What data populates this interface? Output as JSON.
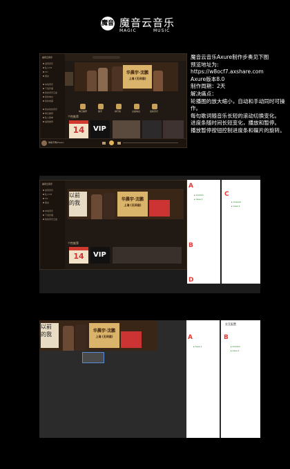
{
  "logo": {
    "cn": "魔音云音乐",
    "en_left": "MAGIC",
    "en_right": "MUSIC",
    "seal": "魔音"
  },
  "description": {
    "lines": [
      "魔音云音乐Axure制作步奏见下图",
      "预览地址为:",
      "https://w8ocf7.axshare.com",
      "Axure版本8.0",
      "制作周期：2天",
      "解决痛点：",
      "轮播图的放大缩小，自动和手动同时可操作。",
      "每句歌词随音乐长短的滚动切换变化。",
      "进度条随时间长短变化，播放和暂停。",
      "播放暂停按钮控制进度条和碟片的旋转。"
    ]
  },
  "app": {
    "brand": "魔音云音乐",
    "sidebar_items": [
      "发现音乐",
      "私人FM",
      "MV",
      "朋友",
      "",
      "本地音乐",
      "下载管理",
      "我的音乐云盘",
      "我的电台",
      "我的收藏",
      "",
      "我喜欢的音乐",
      "每日推荐",
      "私人歌单",
      "编辑推荐"
    ],
    "banner_title": "华晨宇·沈鹏",
    "banner_sub": "上海 (无间道)",
    "poster_text": "以前\n的我",
    "quick_labels": [
      "每日推荐",
      "歌手",
      "排行榜",
      "主播电台",
      "最新音乐"
    ],
    "section_title": "个性推荐",
    "calendar_day": "14",
    "vip_text": "VIP",
    "now_playing": "你我不再(Fever)"
  },
  "annotations": {
    "s2": [
      "A",
      "B",
      "C",
      "D"
    ],
    "s3": [
      "A",
      "B"
    ],
    "s3_panel_title": "交互配置"
  },
  "colors": {
    "background": "#000000",
    "accent": "#e0b35b",
    "annotation": "#e53935",
    "tree_text": "#1a7a1a"
  }
}
